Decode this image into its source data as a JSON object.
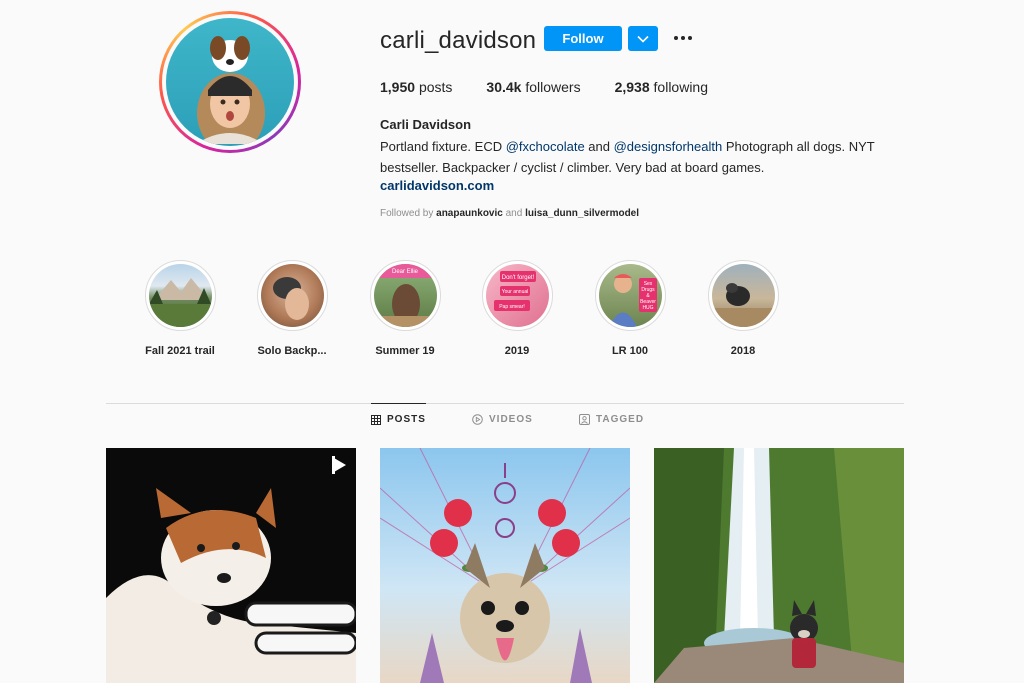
{
  "profile": {
    "username": "carli_davidson",
    "follow_label": "Follow",
    "posts_count": "1,950",
    "posts_label": "posts",
    "followers_count": "30.4k",
    "followers_label": "followers",
    "following_count": "2,938",
    "following_label": "following",
    "full_name": "Carli Davidson",
    "bio_1": "Portland fixture. ECD ",
    "bio_mention_1": "@fxchocolate",
    "bio_2": " and ",
    "bio_mention_2": "@designsforhealth",
    "bio_3": " Photograph all dogs. NYT bestseller. Backpacker / cyclist / climber. Very bad at board games.",
    "website": "carlidavidson.com",
    "followed_prefix": "Followed by ",
    "followed_user_1": "anapaunkovic",
    "followed_and": " and ",
    "followed_user_2": "luisa_dunn_silvermodel"
  },
  "highlights": [
    {
      "label": "Fall 2021 trail"
    },
    {
      "label": "Solo Backp..."
    },
    {
      "label": "Summer 19",
      "sticker": "Dear Ellie"
    },
    {
      "label": "2019",
      "sticker_1": "Don't forget!",
      "sticker_2": "Your annual",
      "sticker_3": "Pap smear!"
    },
    {
      "label": "LR 100",
      "sticker_1": "Sex",
      "sticker_2": "Drugs",
      "sticker_3": "&",
      "sticker_4": "Beaver",
      "sticker_5": "HUG"
    },
    {
      "label": "2018"
    }
  ],
  "tabs": [
    {
      "label": "POSTS",
      "icon": "grid-icon",
      "active": true
    },
    {
      "label": "VIDEOS",
      "icon": "play-circle-icon",
      "active": false
    },
    {
      "label": "TAGGED",
      "icon": "tag-person-icon",
      "active": false
    }
  ],
  "colors": {
    "follow_blue": "#0095f6",
    "link_blue": "#00376b",
    "text": "#262626",
    "muted": "#8e8e8e"
  }
}
